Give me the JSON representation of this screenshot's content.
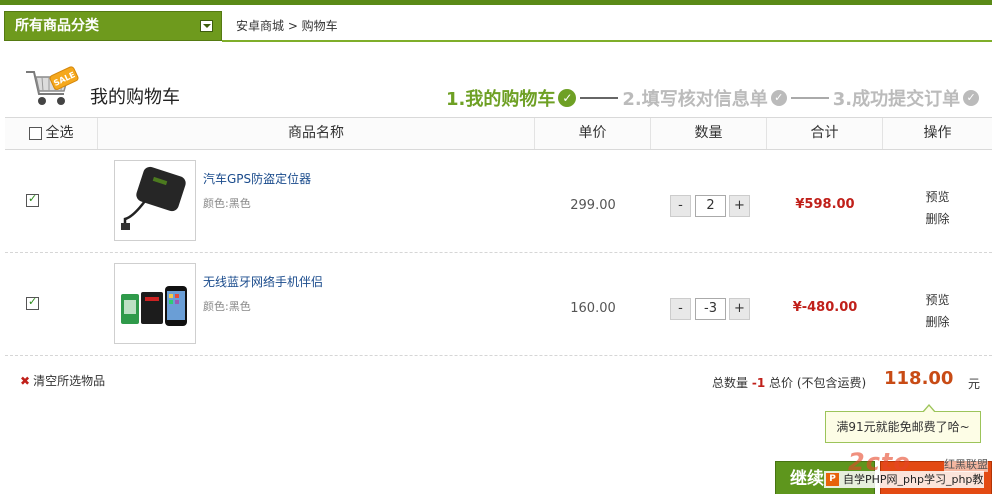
{
  "header": {
    "category_button": "所有商品分类",
    "breadcrumb": "安卓商城 > 购物车"
  },
  "cart": {
    "sale_badge": "SALE",
    "title": "我的购物车"
  },
  "steps": [
    {
      "label": "1.我的购物车",
      "active": true
    },
    {
      "label": "2.填写核对信息单",
      "active": false
    },
    {
      "label": "3.成功提交订单",
      "active": false
    }
  ],
  "table": {
    "headers": {
      "select_all": "全选",
      "name": "商品名称",
      "unit_price": "单价",
      "quantity": "数量",
      "subtotal": "合计",
      "actions": "操作"
    },
    "rows": [
      {
        "checked": true,
        "name": "汽车GPS防盗定位器",
        "attr": "颜色:黑色",
        "price": "299.00",
        "qty": "2",
        "subtotal": "¥598.00",
        "op_preview": "预览",
        "op_delete": "删除"
      },
      {
        "checked": true,
        "name": "无线蓝牙网络手机伴侣",
        "attr": "颜色:黑色",
        "price": "160.00",
        "qty": "-3",
        "subtotal": "¥-480.00",
        "op_preview": "预览",
        "op_delete": "删除"
      }
    ],
    "qty_minus": "-",
    "qty_plus": "+"
  },
  "footer": {
    "clear_selected": "清空所选物品",
    "total_qty_label": "总数量",
    "total_qty": "-1",
    "total_price_label": "总价 (不包含运费)",
    "total_amount": "118.00",
    "currency_unit": "元",
    "free_shipping_tip": "满91元就能免邮费了哈~",
    "continue_button": "继续"
  },
  "watermark": {
    "logo": "2cto",
    "brand": "红黑联盟",
    "bar_text": "自学PHP网_php学习_php教"
  },
  "colors": {
    "brand_green": "#6ea024",
    "price_red": "#c0201a",
    "total_orange": "#c84b15"
  }
}
